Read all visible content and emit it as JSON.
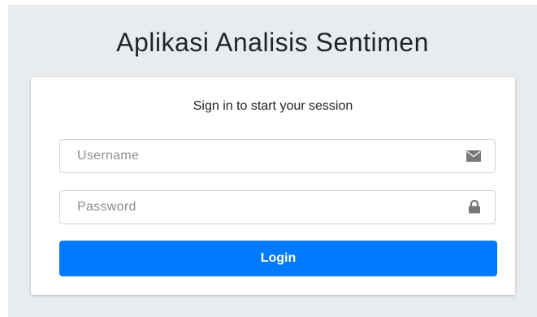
{
  "app": {
    "title": "Aplikasi Analisis Sentimen"
  },
  "login": {
    "message": "Sign in to start your session",
    "username": {
      "placeholder": "Username",
      "value": "",
      "icon": "envelope-icon"
    },
    "password": {
      "placeholder": "Password",
      "value": "",
      "icon": "lock-icon"
    },
    "submit_label": "Login"
  },
  "colors": {
    "page_background": "#e9ecef",
    "card_background": "#ffffff",
    "primary": "#007bff",
    "input_border": "#ced4da",
    "icon": "#777777"
  }
}
